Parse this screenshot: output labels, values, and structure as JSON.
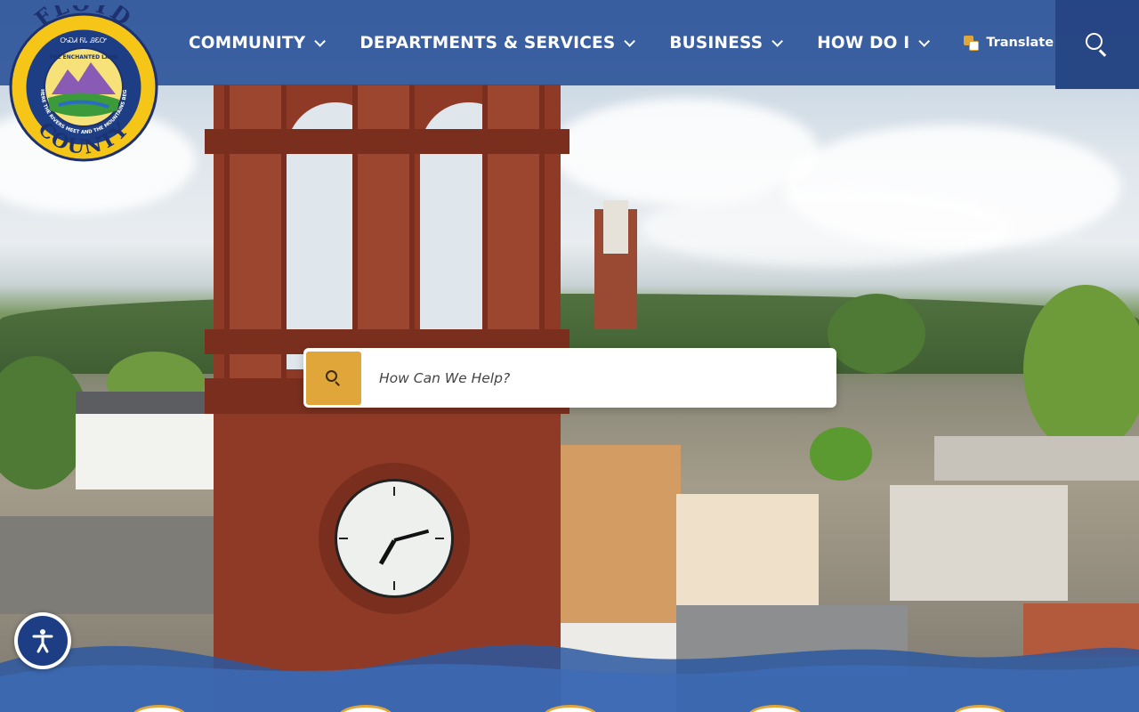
{
  "site": {
    "seal": {
      "top_text": "FLOYD",
      "bottom_text": "COUNTY",
      "inner_text": "THE ENCHANTED LAND",
      "ring_text": "WHERE THE RIVERS MEET AND THE MOUNTAINS BEGIN",
      "cherokee_text": "ᎤᏍᏗ ᏲᏓ ᎯᏋᏅ"
    }
  },
  "nav": {
    "items": [
      {
        "label": "COMMUNITY"
      },
      {
        "label": "DEPARTMENTS & SERVICES"
      },
      {
        "label": "BUSINESS"
      },
      {
        "label": "HOW DO I"
      }
    ],
    "translate_label": "Translate"
  },
  "search": {
    "placeholder": "How Can We Help?"
  },
  "colors": {
    "nav_bg": "#274e96",
    "accent_gold": "#e0a63a",
    "a11y_blue": "#1d3e84",
    "wave_blue": "#2c58a0"
  },
  "icons": {
    "search": "search-icon",
    "chevron": "chevron-down-icon",
    "translate": "translate-icon",
    "accessibility": "accessibility-icon"
  }
}
